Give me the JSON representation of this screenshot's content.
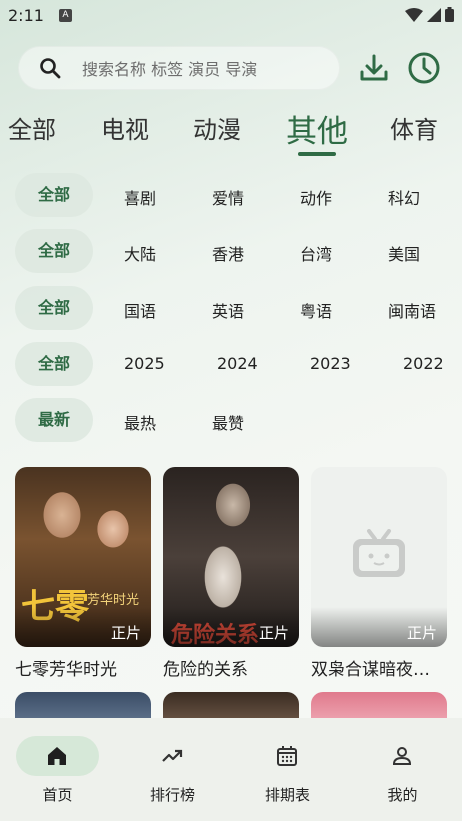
{
  "status": {
    "time": "2:11",
    "notif_badge": "A"
  },
  "search": {
    "placeholder": "搜索名称 标签 演员 导演"
  },
  "header_icons": [
    "download-icon",
    "history-clock-icon"
  ],
  "categories": [
    {
      "label": "全部",
      "active": false
    },
    {
      "label": "电视",
      "active": false
    },
    {
      "label": "动漫",
      "active": false
    },
    {
      "label": "其他",
      "active": true
    },
    {
      "label": "体育",
      "active": false
    }
  ],
  "filters": {
    "genre": {
      "selected": "全部",
      "options": [
        "喜剧",
        "爱情",
        "动作",
        "科幻"
      ]
    },
    "region": {
      "selected": "全部",
      "options": [
        "大陆",
        "香港",
        "台湾",
        "美国"
      ]
    },
    "language": {
      "selected": "全部",
      "options": [
        "国语",
        "英语",
        "粤语",
        "闽南语"
      ]
    },
    "year": {
      "selected": "全部",
      "options": [
        "2025",
        "2024",
        "2023",
        "2022"
      ]
    },
    "sort": {
      "selected": "最新",
      "options": [
        "最热",
        "最赞"
      ]
    }
  },
  "items": [
    {
      "title": "七零芳华时光",
      "tag": "正片",
      "poster_text": "七零芳华时光"
    },
    {
      "title": "危险的关系",
      "tag": "正片",
      "poster_text": "危险关系"
    },
    {
      "title": "双枭合谋暗夜…",
      "tag": "正片",
      "poster_text": ""
    }
  ],
  "nav": [
    {
      "label": "首页",
      "icon": "home-icon",
      "active": true
    },
    {
      "label": "排行榜",
      "icon": "trending-icon",
      "active": false
    },
    {
      "label": "排期表",
      "icon": "calendar-icon",
      "active": false
    },
    {
      "label": "我的",
      "icon": "user-icon",
      "active": false
    }
  ],
  "colors": {
    "accent": "#2f6b45",
    "chip_bg": "#dde8df",
    "nav_bg": "#eef1ec"
  }
}
